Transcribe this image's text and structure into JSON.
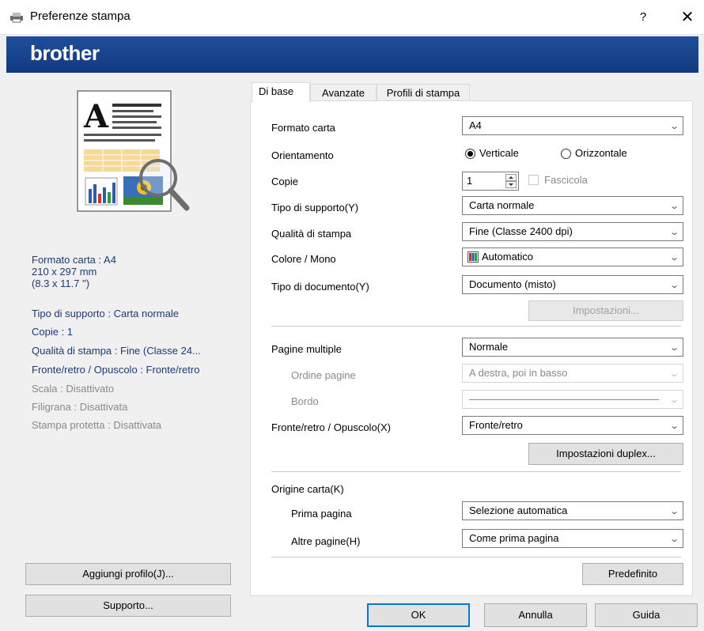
{
  "window": {
    "title": "Preferenze stampa",
    "help_label": "?",
    "close_label": "✕",
    "brand": "brother"
  },
  "summary": {
    "items": [
      "Formato carta : A4",
      "210 x 297 mm",
      "(8.3 x 11.7 \")",
      "Tipo di supporto : Carta normale",
      "Copie : 1",
      "Qualità di stampa : Fine (Classe 24...",
      "Fronte/retro / Opuscolo : Fronte/retro",
      "Scala : Disattivato",
      "Filigrana : Disattivata",
      "Stampa protetta : Disattivata"
    ]
  },
  "left_buttons": {
    "add_profile": "Aggiungi profilo(J)...",
    "support": "Supporto..."
  },
  "tabs": [
    "Di base",
    "Avanzate",
    "Profili di stampa"
  ],
  "form": {
    "paper_size": {
      "label": "Formato carta",
      "value": "A4"
    },
    "orientation": {
      "label": "Orientamento",
      "portrait": "Verticale",
      "landscape": "Orizzontale",
      "selected": "Verticale"
    },
    "copies": {
      "label": "Copie",
      "value": "1",
      "collate_label": "Fascicola"
    },
    "media_type": {
      "label": "Tipo di supporto(Y)",
      "value": "Carta normale"
    },
    "print_quality": {
      "label": "Qualità di stampa",
      "value": "Fine (Classe 2400 dpi)"
    },
    "color_mono": {
      "label": "Colore / Mono",
      "value": "Automatico"
    },
    "document_type": {
      "label": "Tipo di documento(Y)",
      "value": "Documento (misto)"
    },
    "settings_button": "Impostazioni...",
    "multiple_pages": {
      "label": "Pagine multiple",
      "value": "Normale"
    },
    "page_order": {
      "label": "Ordine pagine",
      "value": "A destra, poi in basso"
    },
    "border": {
      "label": "Bordo"
    },
    "duplex": {
      "label": "Fronte/retro / Opuscolo(X)",
      "value": "Fronte/retro"
    },
    "duplex_settings_button": "Impostazioni duplex...",
    "paper_source": {
      "label": "Origine carta(K)"
    },
    "first_page": {
      "label": "Prima pagina",
      "value": "Selezione automatica"
    },
    "other_pages": {
      "label": "Altre pagine(H)",
      "value": "Come prima pagina"
    },
    "default_button": "Predefinito"
  },
  "footer": {
    "ok": "OK",
    "cancel": "Annulla",
    "help": "Guida"
  },
  "colors": {
    "banner": "#1f4e9b",
    "summary_text": "#1b3a78",
    "disabled_text": "#8a8a8a"
  }
}
